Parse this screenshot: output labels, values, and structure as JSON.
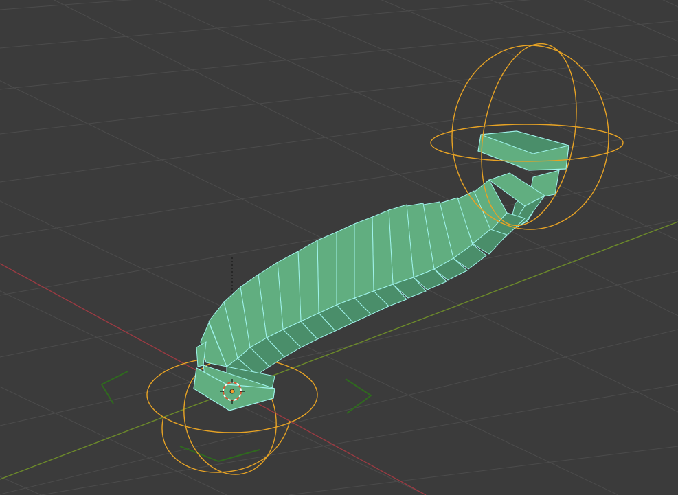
{
  "viewport": {
    "type": "3d-viewport",
    "object": "curved-segmented-tube",
    "mode": "edit-mesh-selected",
    "colors": {
      "background": "#3b3b3b",
      "grid_line": "#4a4a4a",
      "x_axis": "#9b3a42",
      "y_axis": "#6c8a2a",
      "mesh_face_light": "#61ae80",
      "mesh_face_dark": "#4a8e6a",
      "mesh_edge_selected": "#9ff2ea",
      "gizmo_ring": "#e7a325",
      "cursor": "#e0542c",
      "bracket": "#2f6a1e"
    },
    "icons": [
      "3d-cursor-icon",
      "origin-point-icon"
    ]
  }
}
